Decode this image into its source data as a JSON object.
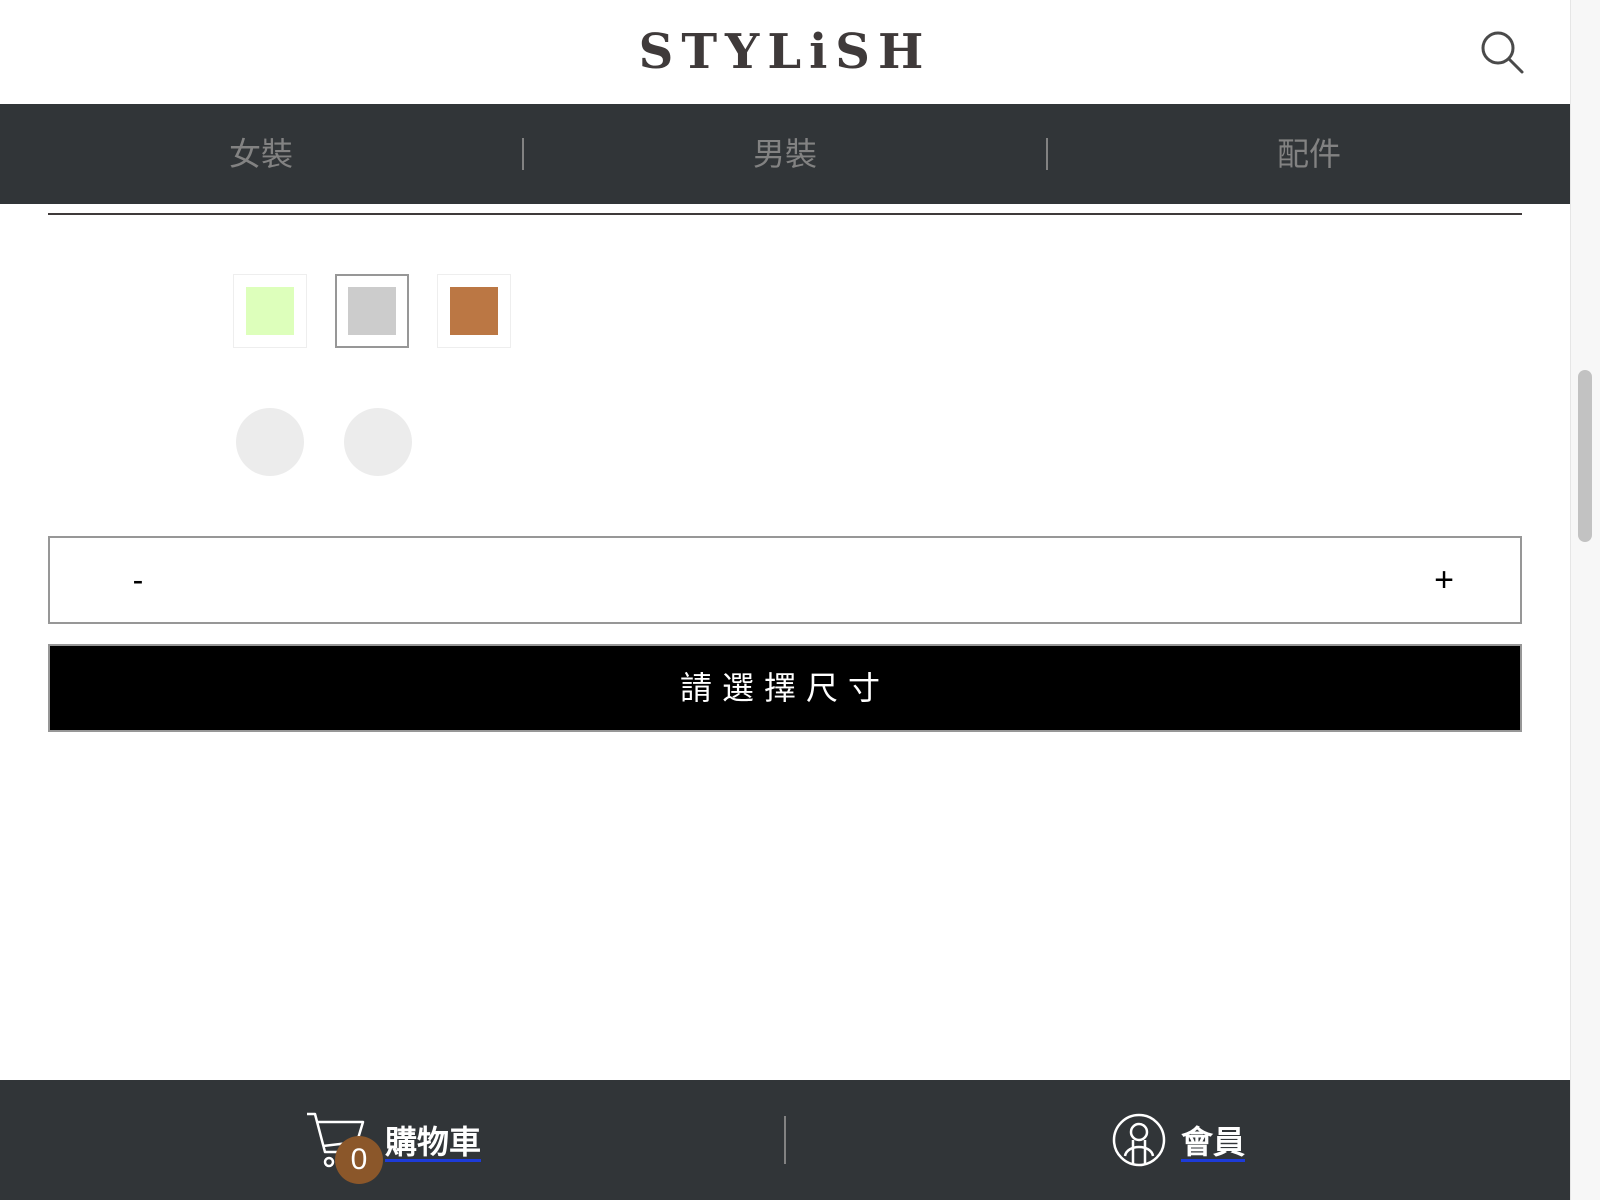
{
  "header": {
    "logo_text": "STYLiSH",
    "search_icon": "search-icon"
  },
  "categories": [
    {
      "label": "女裝"
    },
    {
      "label": "男裝"
    },
    {
      "label": "配件"
    }
  ],
  "product": {
    "colors": [
      {
        "hex": "#DDFFBB",
        "selected": false
      },
      {
        "hex": "#CCCCCC",
        "selected": true
      },
      {
        "hex": "#BB7744",
        "selected": false
      }
    ],
    "sizes_count_visible": 2,
    "quantity": {
      "minus_label": "-",
      "plus_label": "+",
      "value": ""
    },
    "cta_label": "請選擇尺寸"
  },
  "bottom_nav": {
    "cart_label": "購物車",
    "cart_count": "0",
    "member_label": "會員",
    "cart_icon": "cart-icon",
    "member_icon": "member-icon"
  },
  "colors": {
    "nav_bg": "#313538",
    "nav_text": "#828282",
    "badge_bg": "#8B572A",
    "cta_bg": "#000000"
  }
}
